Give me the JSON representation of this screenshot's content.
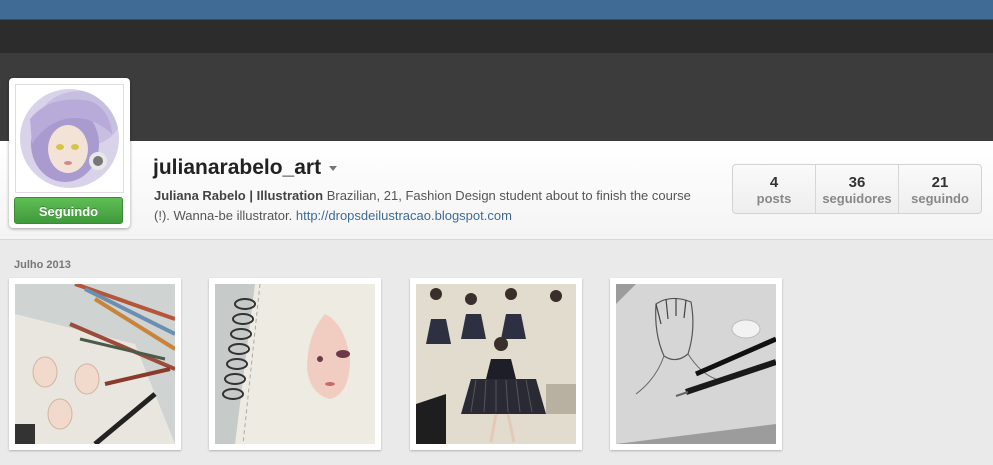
{
  "profile": {
    "username": "julianarabelo_art",
    "follow_label": "Seguindo",
    "bio_name": "Juliana Rabelo | Illustration",
    "bio_text": "Brazilian, 21, Fashion Design student about to finish the course (!). Wanna-be illustrator.",
    "bio_link": "http://dropsdeilustracao.blogspot.com"
  },
  "stats": [
    {
      "count": "4",
      "label": "posts"
    },
    {
      "count": "36",
      "label": "seguidores"
    },
    {
      "count": "21",
      "label": "seguindo"
    }
  ],
  "feed": {
    "month_label": "Julho 2013"
  },
  "colors": {
    "topbar": "#3f6b95",
    "follow_button": "#4cae45"
  }
}
